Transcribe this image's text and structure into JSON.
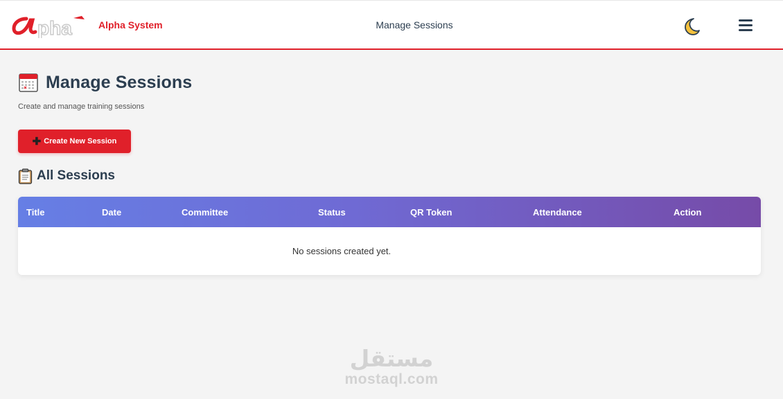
{
  "header": {
    "logo_text": "Alpha",
    "brand_name": "Alpha System",
    "page_title": "Manage Sessions",
    "theme_icon": "moon-icon",
    "menu_icon": "hamburger-menu-icon"
  },
  "page": {
    "title": "Manage Sessions",
    "title_icon": "calendar-icon",
    "subtitle": "Create and manage training sessions",
    "create_button_label": "Create New Session",
    "create_button_icon": "plus-icon"
  },
  "sessions": {
    "title": "All Sessions",
    "title_icon": "clipboard-icon",
    "columns": [
      "Title",
      "Date",
      "Committee",
      "Status",
      "QR Token",
      "Attendance",
      "Action"
    ],
    "rows": [],
    "empty_message": "No sessions created yet."
  },
  "watermark": {
    "arabic": "مستقل",
    "latin": "mostaql.com"
  },
  "colors": {
    "accent": "#e0202a",
    "header_gradient_start": "#667fe5",
    "header_gradient_end": "#764ba8",
    "text_dark": "#2c3e50",
    "background": "#f4f4f4"
  }
}
